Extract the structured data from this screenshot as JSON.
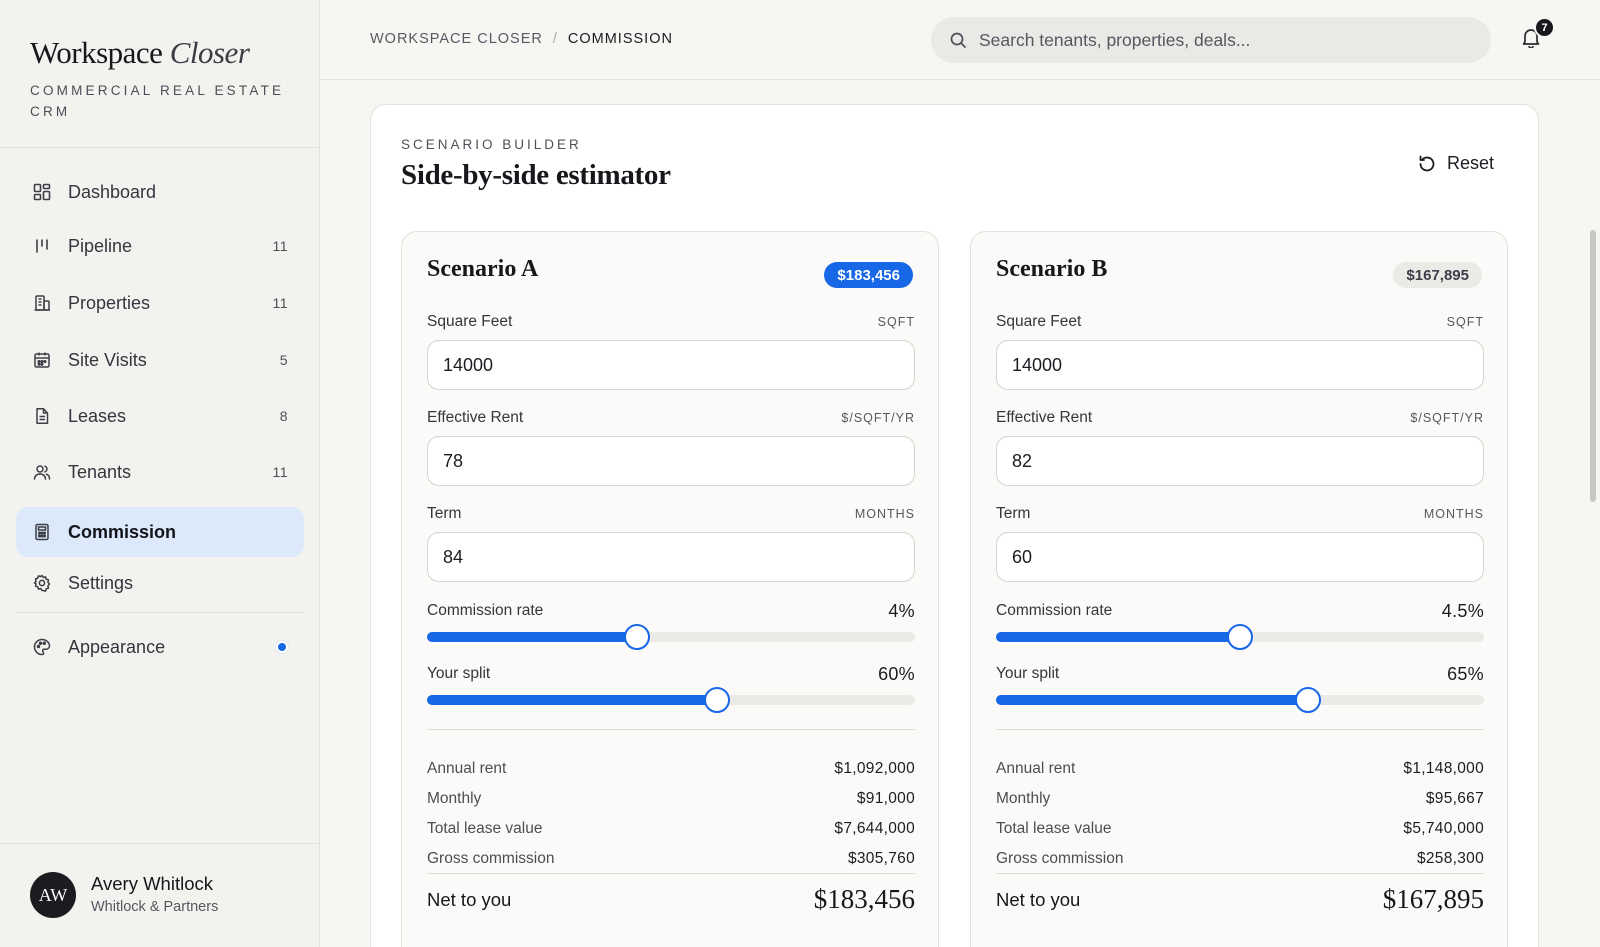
{
  "brand": {
    "name": "Workspace",
    "name_italic": "Closer",
    "tagline": "COMMERCIAL REAL ESTATE CRM"
  },
  "nav": {
    "items": [
      {
        "label": "Dashboard",
        "count": "",
        "icon": "grid-icon"
      },
      {
        "label": "Pipeline",
        "count": "11",
        "icon": "pipeline-icon"
      },
      {
        "label": "Properties",
        "count": "11",
        "icon": "building-icon"
      },
      {
        "label": "Site Visits",
        "count": "5",
        "icon": "calendar-icon"
      },
      {
        "label": "Leases",
        "count": "8",
        "icon": "document-icon"
      },
      {
        "label": "Tenants",
        "count": "11",
        "icon": "users-icon"
      },
      {
        "label": "Commission",
        "count": "",
        "icon": "calculator-icon",
        "active": true
      },
      {
        "label": "Settings",
        "count": "",
        "icon": "gear-icon"
      }
    ],
    "appearance": {
      "label": "Appearance",
      "icon": "palette-icon"
    }
  },
  "user": {
    "initials": "AW",
    "name": "Avery Whitlock",
    "org": "Whitlock & Partners"
  },
  "header": {
    "breadcrumb": [
      "WORKSPACE CLOSER",
      "COMMISSION"
    ],
    "breadcrumb_sep": "/",
    "search_placeholder": "Search tenants, properties, deals...",
    "notifications": "7"
  },
  "builder": {
    "eyebrow": "SCENARIO BUILDER",
    "title": "Side-by-side estimator",
    "reset_label": "Reset"
  },
  "labels": {
    "square_feet": "Square Feet",
    "sqft_unit": "SQFT",
    "effective_rent": "Effective Rent",
    "rent_unit": "$/SQFT/YR",
    "term": "Term",
    "term_unit": "MONTHS",
    "commission_rate": "Commission rate",
    "your_split": "Your split",
    "annual_rent": "Annual rent",
    "monthly": "Monthly",
    "total_lease_value": "Total lease value",
    "gross_commission": "Gross commission",
    "net_to_you": "Net to you"
  },
  "scenarios": [
    {
      "title": "Scenario A",
      "badge": "$183,456",
      "square_feet": "14000",
      "effective_rent": "78",
      "term": "84",
      "commission_rate": "4%",
      "commission_rate_fraction": 0.43,
      "your_split": "60%",
      "your_split_fraction": 0.595,
      "annual_rent": "$1,092,000",
      "monthly": "$91,000",
      "total_lease_value": "$7,644,000",
      "gross_commission": "$305,760",
      "net_to_you": "$183,456"
    },
    {
      "title": "Scenario B",
      "badge": "$167,895",
      "square_feet": "14000",
      "effective_rent": "82",
      "term": "60",
      "commission_rate": "4.5%",
      "commission_rate_fraction": 0.5,
      "your_split": "65%",
      "your_split_fraction": 0.64,
      "annual_rent": "$1,148,000",
      "monthly": "$95,667",
      "total_lease_value": "$5,740,000",
      "gross_commission": "$258,300",
      "net_to_you": "$167,895"
    }
  ],
  "colors": {
    "accent": "#1767e6",
    "active_nav_bg": "#dce9fb",
    "badge_muted_bg": "#ebeae7"
  }
}
